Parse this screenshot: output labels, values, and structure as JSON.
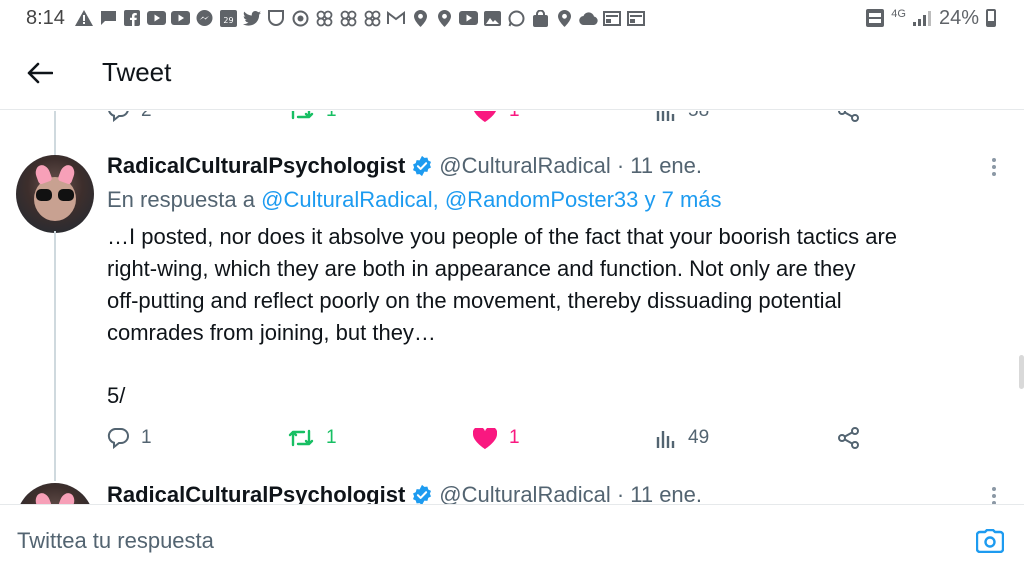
{
  "status_bar": {
    "time": "8:14",
    "battery": "24%",
    "network": "4G",
    "calendar_day": "29"
  },
  "header": {
    "title": "Tweet",
    "back_icon": "arrow-left-icon"
  },
  "prev_tweet_actions": {
    "replies": "2",
    "retweets": "1",
    "likes": "1",
    "views": "58"
  },
  "tweet": {
    "display_name": "RadicalCulturalPsychologist",
    "handle": "@CulturalRadical",
    "date": "· 11 ene.",
    "reply_prefix": "En respuesta a",
    "reply_mentions": "@CulturalRadical, @RandomPoster33 y 7 más",
    "body_lines": [
      "…I posted, nor does it absolve you people of the fact that your boorish tactics are",
      "right-wing, which they are both in appearance and function. Not only are they",
      "off-putting and reflect poorly on the movement, thereby dissuading potential",
      "comrades from joining, but they…"
    ],
    "thread_number": "5/",
    "replies": "1",
    "retweets": "1",
    "likes": "1",
    "views": "49"
  },
  "next_tweet": {
    "display_name": "RadicalCulturalPsychologist",
    "handle": "@CulturalRadical",
    "date": "· 11 ene."
  },
  "composer": {
    "placeholder": "Twittea tu respuesta"
  },
  "colors": {
    "accent": "#1d9bf0",
    "retweet": "#17bf63",
    "like": "#f91880",
    "secondary_text": "#536471"
  }
}
